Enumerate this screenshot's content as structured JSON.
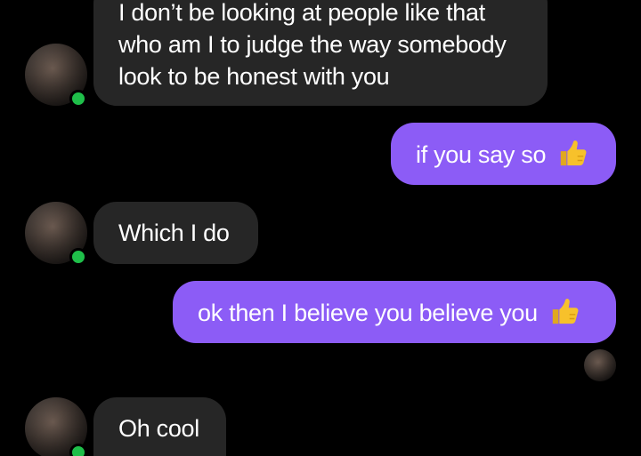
{
  "conversation": {
    "messages": [
      {
        "direction": "incoming",
        "lines": [
          "I don’t be looking at people like that",
          "who am I to judge the way somebody",
          "look to be honest with you"
        ]
      },
      {
        "direction": "outgoing",
        "text": "if you say so",
        "emoji": "thumbs-up-icon"
      },
      {
        "direction": "incoming",
        "text": "Which I do"
      },
      {
        "direction": "outgoing",
        "text": "ok then I believe you believe you",
        "emoji": "thumbs-up-icon"
      },
      {
        "direction": "incoming",
        "text": "Oh cool"
      }
    ]
  },
  "colors": {
    "background": "#000000",
    "incoming_bubble": "#262626",
    "outgoing_bubble": "#8c5cf6",
    "online_dot": "#1fbf4a",
    "emoji": "#f7c12b"
  }
}
